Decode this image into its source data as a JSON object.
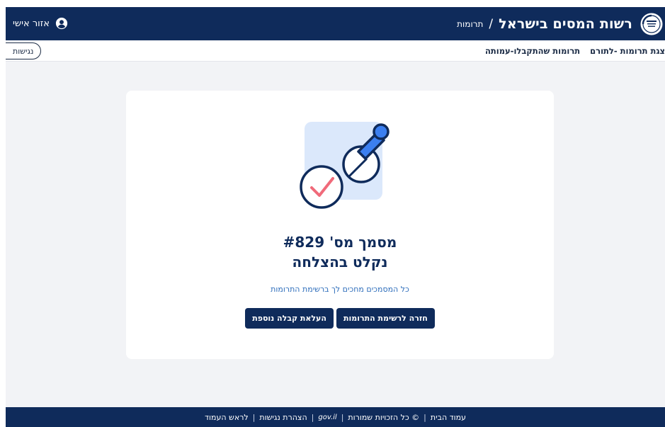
{
  "header": {
    "user_label": "אזור אישי",
    "brand_title": "רשות המסים בישראל",
    "separator": "/",
    "breadcrumb": "תרומות"
  },
  "subnav": {
    "accessibility_label": "נגישות",
    "tabs": [
      {
        "label": "צגת תרומות -לתורם"
      },
      {
        "label": "תרומות שהתקבלו-עמותה"
      }
    ]
  },
  "card": {
    "title_line1": "מסמך מס' #829",
    "title_line2": "נקלט בהצלחה",
    "subtitle": "כל המסמכים מחכים לך ברשימת התרומות",
    "buttons": {
      "back_to_list": "חזרה לרשימת התרומות",
      "upload_another": "העלאת קבלה נוספת"
    }
  },
  "footer": {
    "home": "עמוד הבית",
    "copyright": "© כל הזכויות שמורות",
    "gov_logo": "gov.il",
    "accessibility_statement": "הצהרת נגישות",
    "top_of_page": "לראש העמוד",
    "separator": "|"
  },
  "colors": {
    "header_bg": "#0f2b5b",
    "page_bg": "#f2f3f6",
    "accent_blue": "#2d6dbb",
    "illustration_bg": "#dbe8fb",
    "check_red": "#f06a7a",
    "stamp_blue": "#3b7ff0"
  },
  "icons": {
    "user": "user-circle-icon",
    "logo": "tax-authority-logo",
    "illustration": "stamp-check-illustration"
  }
}
